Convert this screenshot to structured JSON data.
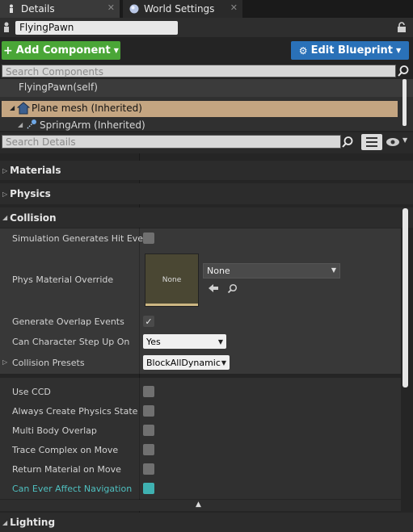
{
  "tabs": [
    {
      "label": "Details",
      "icon": "details-icon",
      "active": true
    },
    {
      "label": "World Settings",
      "icon": "globe-icon",
      "active": false
    }
  ],
  "actor": {
    "name": "FlyingPawn"
  },
  "toolbar": {
    "add_component_label": "Add Component",
    "edit_blueprint_label": "Edit Blueprint",
    "add_color": "#4aa637",
    "edit_color": "#2a71b8"
  },
  "components": {
    "search_placeholder": "Search Components",
    "self_label": "FlyingPawn(self)",
    "items": [
      {
        "label": "Plane mesh (Inherited)",
        "icon": "mesh-icon",
        "selected": true
      },
      {
        "label": "SpringArm (Inherited)",
        "icon": "springarm-icon",
        "selected": false
      }
    ]
  },
  "details": {
    "search_placeholder": "Search Details"
  },
  "sections": {
    "materials": "Materials",
    "physics": "Physics",
    "collision": "Collision",
    "lighting": "Lighting"
  },
  "collision": {
    "sim_hit": "Simulation Generates Hit Event",
    "phys_override": "Phys Material Override",
    "thumb_label": "None",
    "phys_value": "None",
    "overlap": "Generate Overlap Events",
    "step_up": "Can Character Step Up On",
    "step_up_value": "Yes",
    "presets": "Collision Presets",
    "presets_value": "BlockAllDynamic",
    "use_ccd": "Use CCD",
    "always_physics": "Always Create Physics State",
    "multi_body": "Multi Body Overlap",
    "trace_complex": "Trace Complex on Move",
    "return_material": "Return Material on Move",
    "affect_nav": "Can Ever Affect Navigation",
    "affect_nav_color": "#3fb1b1"
  }
}
